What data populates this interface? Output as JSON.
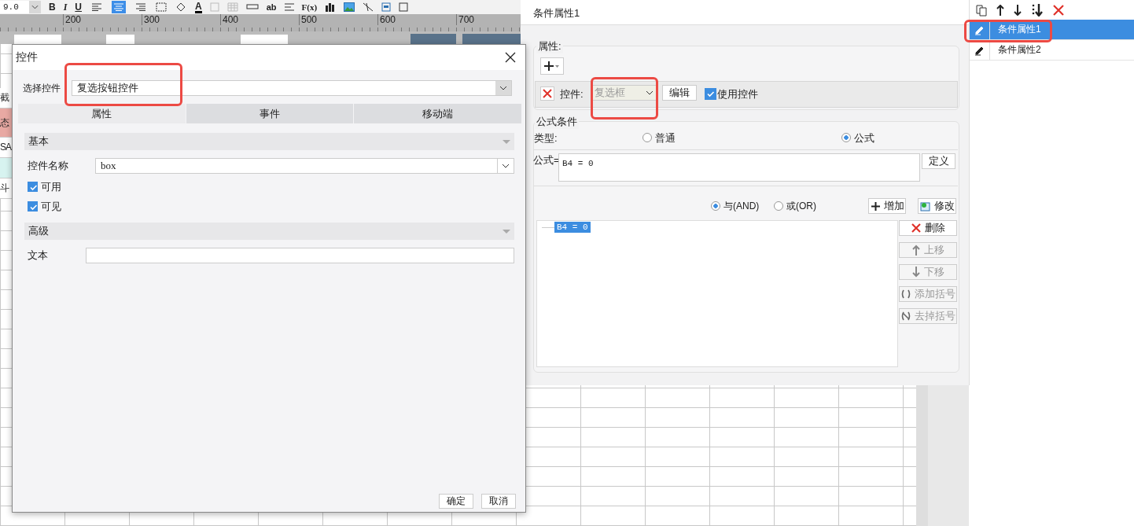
{
  "toolbar": {
    "font_size": "9.0",
    "text_buttons": [
      "B",
      "I",
      "U"
    ],
    "align_buttons": [
      {
        "selected": false
      },
      {
        "selected": true
      },
      {
        "selected": false
      }
    ],
    "extra_text_buttons": [
      "A",
      "ab",
      "F(x)"
    ]
  },
  "ruler": {
    "ticks": [
      "200",
      "300",
      "400",
      "500",
      "600",
      "700"
    ]
  },
  "sheet": {
    "edge_cells": [
      {
        "text": "截",
        "kind": "plain"
      },
      {
        "text": "态",
        "kind": "pink"
      },
      {
        "text": "SA",
        "kind": "plain"
      },
      {
        "text": "",
        "kind": "cyan"
      },
      {
        "text": "斗",
        "kind": "plain"
      }
    ]
  },
  "control_dialog": {
    "title": "控件",
    "select_label": "选择控件",
    "select_value": "复选按钮控件",
    "tabs": [
      {
        "label": "属性",
        "selected": true
      },
      {
        "label": "事件",
        "selected": false
      },
      {
        "label": "移动端",
        "selected": false
      }
    ],
    "basic": {
      "title": "基本",
      "name_label": "控件名称",
      "name_value": "box",
      "checkboxes": [
        {
          "label": "可用",
          "checked": true
        },
        {
          "label": "可见",
          "checked": true
        }
      ]
    },
    "advanced": {
      "title": "高级",
      "text_label": "文本"
    },
    "buttons": [
      "确定",
      "取消"
    ]
  },
  "condition_panel": {
    "title": "条件属性1",
    "attr_legend": "属性:",
    "control_label": "控件:",
    "control_value": "复选框",
    "control_disabled": true,
    "edit_button": "编辑",
    "use_control": {
      "label": "使用控件",
      "checked": true
    },
    "formula_legend": "公式条件",
    "type_label": "类型:",
    "type_options": [
      {
        "label": "普通",
        "selected": false
      },
      {
        "label": "公式",
        "selected": true
      }
    ],
    "formula_label": "公式=",
    "formula_value": "B4 = 0",
    "define_button": "定义",
    "logic_options": [
      {
        "label": "与(AND)",
        "selected": true
      },
      {
        "label": "或(OR)",
        "selected": false
      }
    ],
    "add_button": "增加",
    "modify_button": "修改",
    "conditions": [
      {
        "text": "B4 = 0",
        "selected": true
      }
    ],
    "side_buttons": [
      {
        "label": "删除",
        "kind": "delete",
        "disabled": false
      },
      {
        "label": "上移",
        "kind": "up",
        "disabled": true
      },
      {
        "label": "下移",
        "kind": "down",
        "disabled": true
      },
      {
        "label": "添加括号",
        "kind": "add-paren",
        "disabled": true
      },
      {
        "label": "去掉括号",
        "kind": "remove-paren",
        "disabled": true
      }
    ]
  },
  "property_list": {
    "items": [
      {
        "label": "条件属性1",
        "selected": true
      },
      {
        "label": "条件属性2",
        "selected": false
      }
    ]
  }
}
